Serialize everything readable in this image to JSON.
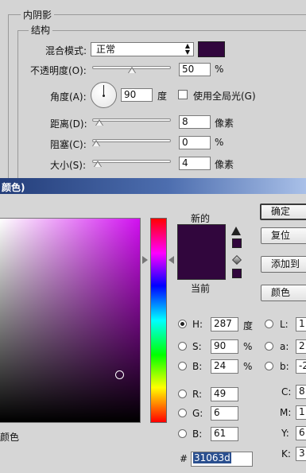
{
  "layer_style": {
    "section_title": "内阴影",
    "group_title": "结构",
    "blend_mode_label": "混合模式:",
    "blend_mode_value": "正常",
    "blend_color": "#31063d",
    "opacity_label": "不透明度(O):",
    "opacity_value": "50",
    "opacity_unit": "%",
    "opacity_level": 0.5,
    "angle_label": "角度(A):",
    "angle_value": "90",
    "angle_unit": "度",
    "global_light_label": "使用全局光(G)",
    "global_light_checked": false,
    "distance_label": "距离(D):",
    "distance_value": "8",
    "distance_unit": "像素",
    "distance_level": 0.04,
    "choke_label": "阻塞(C):",
    "choke_value": "0",
    "choke_unit": "%",
    "choke_level": 0.0,
    "size_label": "大小(S):",
    "size_value": "4",
    "size_unit": "像素",
    "size_level": 0.02
  },
  "color_picker": {
    "title": "颜色)",
    "new_label": "新的",
    "current_label": "当前",
    "new_color": "#31063d",
    "current_color": "#31063d",
    "hue_color": "#d10ff0",
    "marker_color_label": "颜色",
    "buttons": {
      "ok": "确定",
      "reset": "复位",
      "add_swatch": "添加到",
      "libraries": "颜色"
    },
    "hsb": {
      "h_label": "H:",
      "h_value": "287",
      "h_unit": "度",
      "s_label": "S:",
      "s_value": "90",
      "s_unit": "%",
      "b_label": "B:",
      "b_value": "24",
      "b_unit": "%"
    },
    "rgb": {
      "r_label": "R:",
      "r_value": "49",
      "g_label": "G:",
      "g_value": "6",
      "b_label": "B:",
      "b_value": "61"
    },
    "lab": {
      "l_label": "L:",
      "l_value": "1",
      "a_label": "a:",
      "a_value": "2",
      "b_label": "b:",
      "b_value": "-2"
    },
    "cmyk": {
      "c_label": "C:",
      "c_value": "8",
      "m_label": "M:",
      "m_value": "1",
      "y_label": "Y:",
      "y_value": "6",
      "k_label": "K:",
      "k_value": "3"
    },
    "hex_label": "#",
    "hex_value": "31063d",
    "selected_hsb": "H"
  }
}
